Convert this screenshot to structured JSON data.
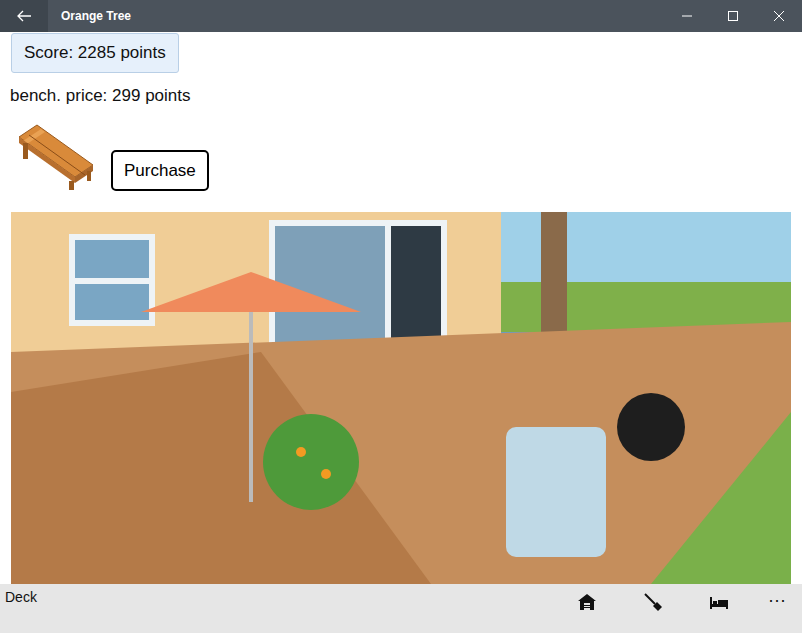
{
  "window": {
    "title": "Orange Tree"
  },
  "score": {
    "label": "Score: 2285 points"
  },
  "item": {
    "price_label": "bench. price: 299 points"
  },
  "purchase_button": {
    "label": "Purchase"
  },
  "command_bar": {
    "label": "Deck",
    "more": "···"
  }
}
